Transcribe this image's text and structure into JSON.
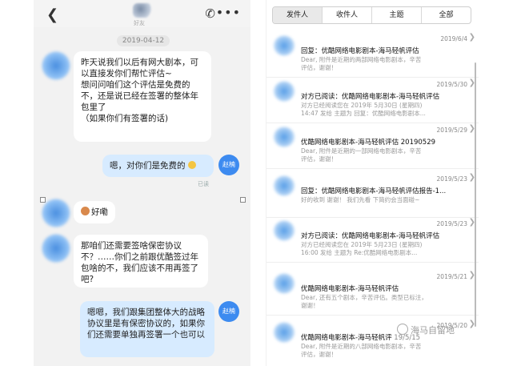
{
  "chat": {
    "contact_name": "好友",
    "date": "2019-04-12",
    "messages": [
      {
        "side": "in",
        "text": "昨天说我们以后有网大剧本，可以直接发你们帮忙评估~\n想问问咱们这个评估是免费的不，还是说已经在签署的整体年包里了\n（如果你们有签署的话)"
      },
      {
        "side": "out",
        "text": "嗯，对你们是免费的"
      },
      {
        "side": "in",
        "text": "好嘞"
      },
      {
        "side": "in",
        "text": "那咱们还需要签啥保密协议不？……你们之前跟优酷签过年包啥的不，我们应该不用再签了吧?"
      },
      {
        "side": "out",
        "text": "嗯嗯，我们跟集团整体大的战略协议里是有保密协议的，如果你们还需要单独再签署一个也可以"
      }
    ],
    "me_name": "赵楠",
    "read_label": "已读"
  },
  "mail": {
    "tabs": [
      "发件人",
      "收件人",
      "主题",
      "全部"
    ],
    "active_tab": 0,
    "items": [
      {
        "date": "2019/6/4",
        "subject": "回复：优酷网络电影剧本-海马轻帆评估",
        "line1": "Dear, 附件是近期的两部网络电影剧本，辛苦",
        "line2": "评估，谢谢！"
      },
      {
        "date": "2019/5/30",
        "subject": "对方已阅读：优酷网络电影剧本-海马轻帆评估",
        "line1": "对方已经阅读您在 2019年 5月30日 (星期四)",
        "line2": "14:47 发给        主题为 回复：优酷网络电影剧本..."
      },
      {
        "date": "2019/5/29",
        "subject": "优酷网络电影剧本-海马轻帆评估 20190529",
        "line1": "Dear, 附件是近期的一部网络电影剧本，辛苦",
        "line2": "评估，谢谢！"
      },
      {
        "date": "2019/5/23",
        "subject": "回复：优酷网络电影剧本-海马轻帆评估报告-1...",
        "line1": "好的收到 谢谢！ 我们先看 下简约会当面碰~",
        "line2": ""
      },
      {
        "date": "2019/5/23",
        "subject": "对方已阅读：优酷网络电影剧本-海马轻帆评估",
        "line1": "对方已经阅读您在 2019年 5月23日 (星期四)",
        "line2": "16:00 发给        主题为 Re:优酷网络电影剧本..."
      },
      {
        "date": "2019/5/21",
        "subject": "优酷网络电影剧本-海马轻帆评估",
        "line1": "Dear, 还有五个剧本，辛苦评估。类型已标注，",
        "line2": "谢谢！"
      },
      {
        "date": "2019/5/20",
        "subject": "优酷网络电影剧本-海马轻帆评",
        "line1": "Dear, 附件是近期的八部网络电影剧本，辛苦",
        "line2": "评估，谢谢！"
      }
    ],
    "partial_date": "19/5/15"
  },
  "watermark": "海马自留地"
}
